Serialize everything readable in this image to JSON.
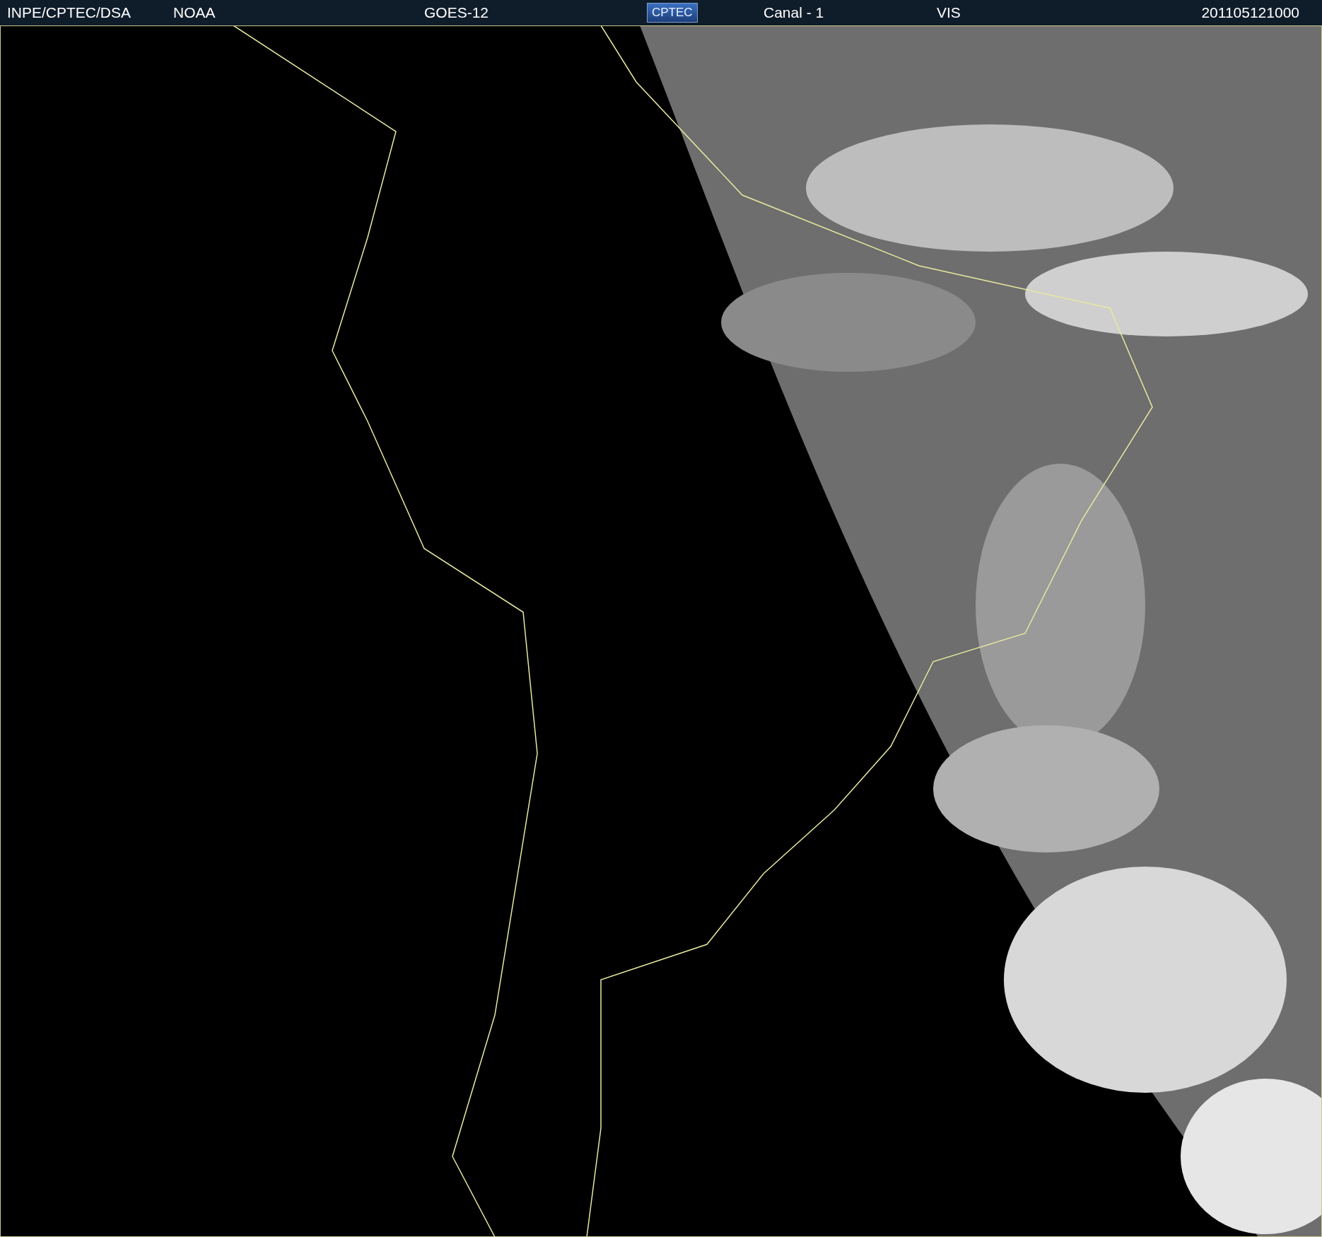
{
  "header": {
    "source": "INPE/CPTEC/DSA",
    "agency": "NOAA",
    "satellite": "GOES-12",
    "logo": "CPTEC",
    "channel": "Canal - 1",
    "band": "VIS",
    "timestamp": "201105121000"
  }
}
